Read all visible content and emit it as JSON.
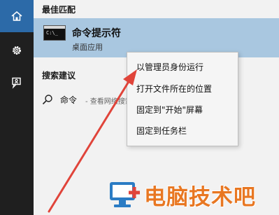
{
  "rail": {
    "icons": [
      "home-icon",
      "gear-icon",
      "feedback-icon"
    ],
    "active_color": "#2c6aa8"
  },
  "best_match": {
    "section_title": "最佳匹配",
    "app_name": "命令提示符",
    "app_type": "桌面应用",
    "icon": "cmd-icon",
    "prompt_text": "C:\\_",
    "highlight_color": "#a9c7e0"
  },
  "suggestions": {
    "section_title": "搜索建议",
    "items": [
      {
        "main": "命令",
        "sub": "- 查看网络搜索结果",
        "icon": "search-icon"
      }
    ]
  },
  "context_menu": {
    "items": [
      "以管理员身份运行",
      "打开文件所在的位置",
      "固定到\"开始\"屏幕",
      "固定到任务栏"
    ]
  },
  "annotation": {
    "arrow_color": "#e0443a"
  },
  "watermark": {
    "text": "电脑技术吧",
    "color": "#e87722"
  }
}
